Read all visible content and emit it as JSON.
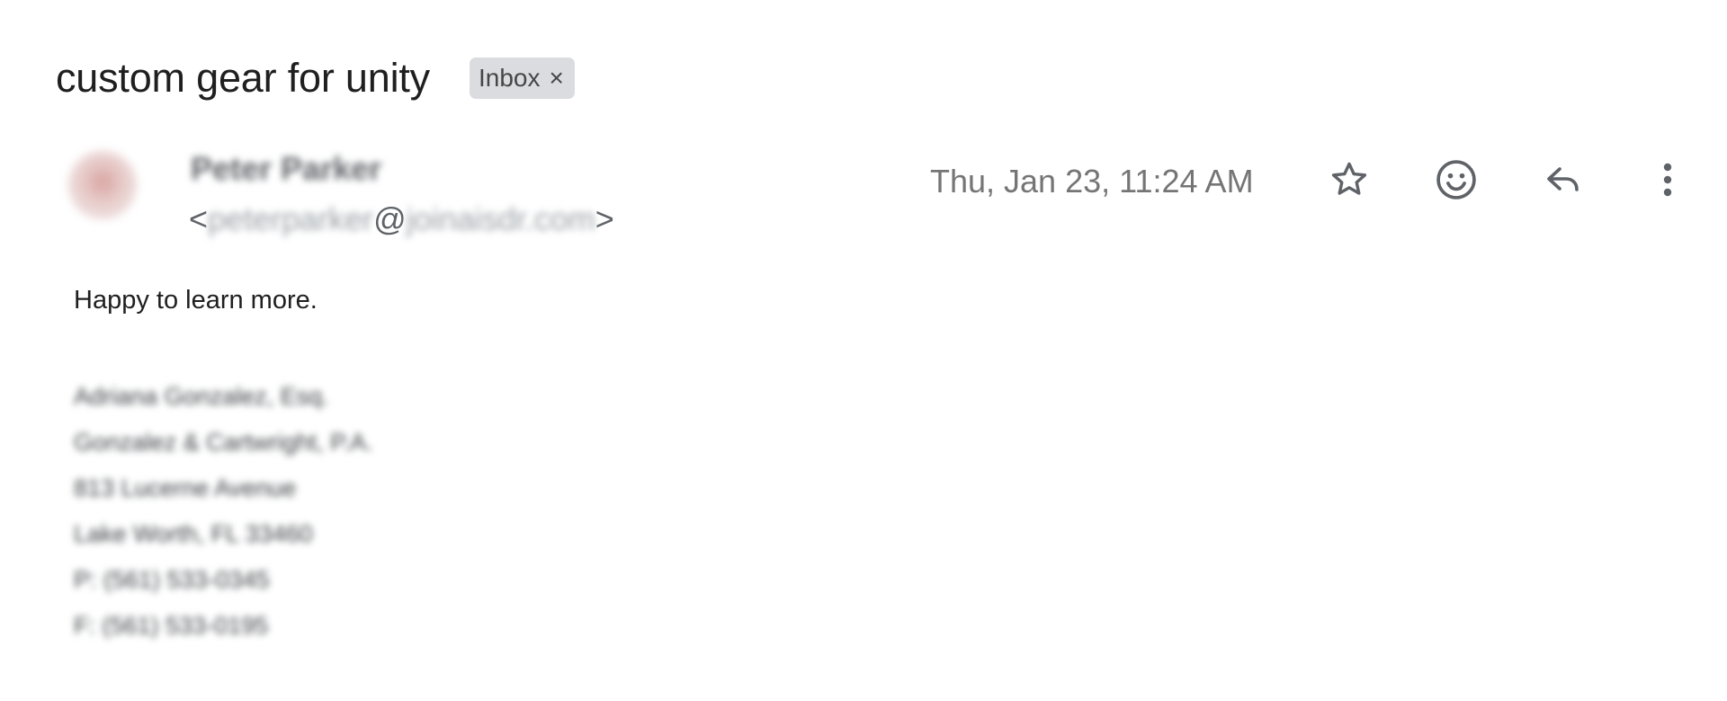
{
  "subject": "custom gear for unity",
  "label_chip": {
    "text": "Inbox",
    "remove_glyph": "×"
  },
  "sender": {
    "name": "Peter Parker",
    "email_open": "<",
    "email_local": "peterparker",
    "email_at": "@",
    "email_domain": "joinaisdr.com",
    "email_close": ">"
  },
  "date": "Thu, Jan 23, 11:24 AM",
  "actions": [
    {
      "icon": "star-icon"
    },
    {
      "icon": "emoji-icon"
    },
    {
      "icon": "reply-icon"
    },
    {
      "icon": "more-vert-icon"
    }
  ],
  "body": {
    "text": "Happy to learn more.",
    "signature": [
      "Adriana Gonzalez, Esq.",
      "Gonzalez & Cartwright, P.A.",
      "813 Lucerne Avenue",
      "Lake Worth, FL 33460",
      "P: (561) 533-0345",
      "F: (561) 533-0195"
    ]
  },
  "colors": {
    "icon": "#5f6368",
    "chip_bg": "#dadce0",
    "date_text": "#757575"
  }
}
